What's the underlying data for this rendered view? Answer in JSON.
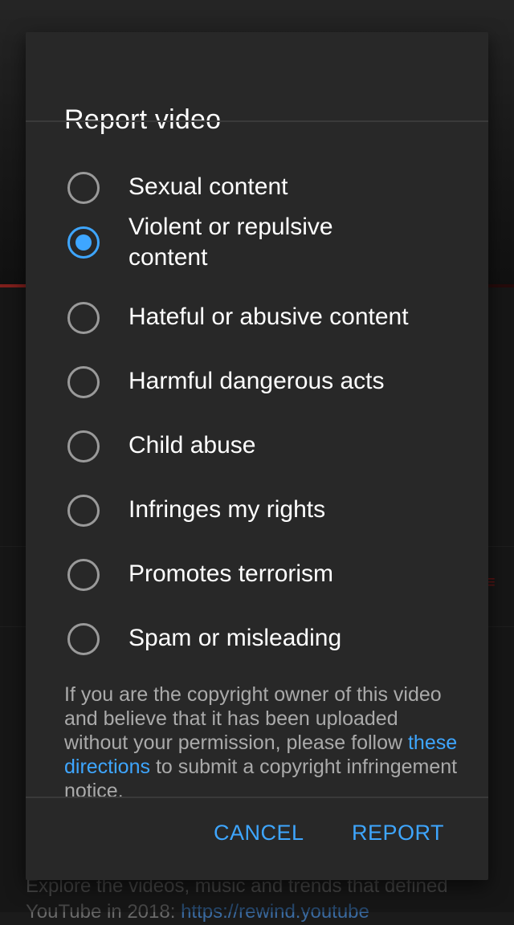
{
  "background": {
    "description_text": "Explore the videos, music and trends that defined",
    "description_text_2": "YouTube in 2018: ",
    "description_link": "https://rewind.youtube"
  },
  "dialog": {
    "title": "Report video",
    "options": [
      {
        "label": "Sexual content",
        "checked": false
      },
      {
        "label": "Violent or repulsive content",
        "checked": true
      },
      {
        "label": "Hateful or abusive content",
        "checked": false
      },
      {
        "label": "Harmful dangerous acts",
        "checked": false
      },
      {
        "label": "Child abuse",
        "checked": false
      },
      {
        "label": "Infringes my rights",
        "checked": false
      },
      {
        "label": "Promotes terrorism",
        "checked": false
      },
      {
        "label": "Spam or misleading",
        "checked": false
      }
    ],
    "notice_before_link": "If you are the copyright owner of this video and believe that it has been uploaded without your permission, please follow ",
    "notice_link": "these directions",
    "notice_after_link": " to submit a copyright infringement notice.",
    "cancel_label": "CANCEL",
    "report_label": "REPORT"
  },
  "colors": {
    "accent": "#3ea6ff",
    "dialog_bg": "#282828",
    "text_primary": "#ffffff",
    "text_secondary": "#aaaaaa"
  }
}
